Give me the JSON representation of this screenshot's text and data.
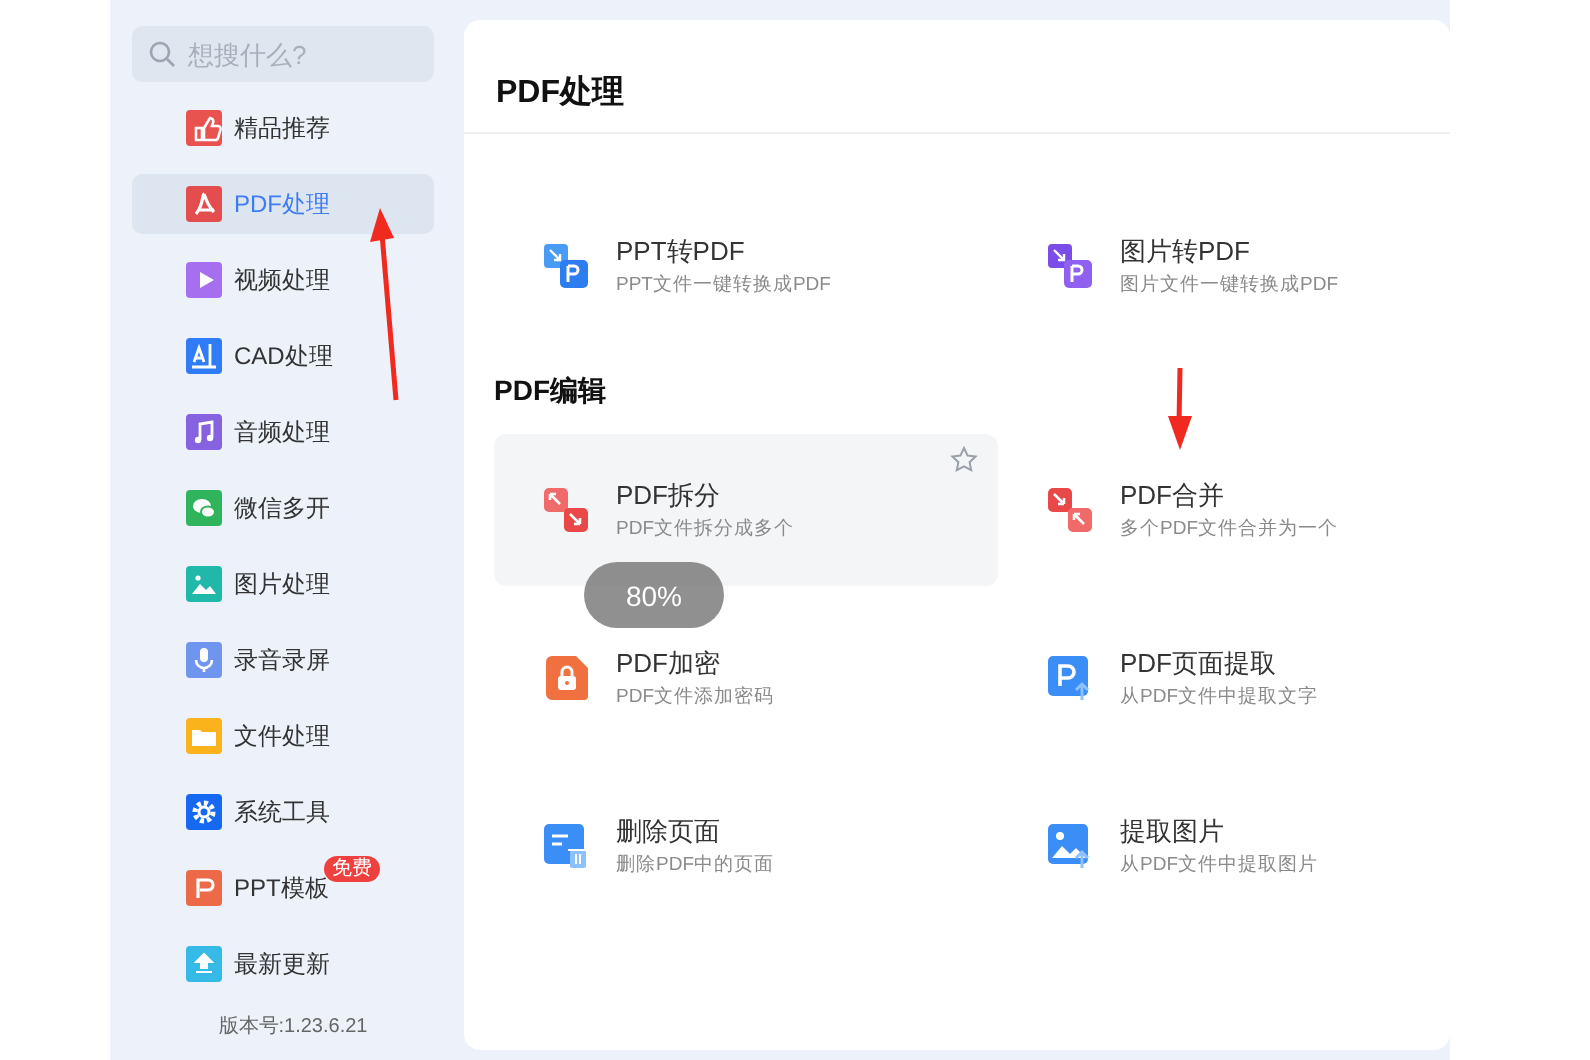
{
  "sidebar": {
    "search": {
      "placeholder": "想搜什么?"
    },
    "items": [
      {
        "label": "精品推荐",
        "kind": "thumb",
        "selected": false
      },
      {
        "label": "PDF处理",
        "kind": "pdf",
        "selected": true
      },
      {
        "label": "视频处理",
        "kind": "video",
        "selected": false
      },
      {
        "label": "CAD处理",
        "kind": "cad",
        "selected": false
      },
      {
        "label": "音频处理",
        "kind": "audio",
        "selected": false
      },
      {
        "label": "微信多开",
        "kind": "chat",
        "selected": false
      },
      {
        "label": "图片处理",
        "kind": "image",
        "selected": false
      },
      {
        "label": "录音录屏",
        "kind": "mic",
        "selected": false
      },
      {
        "label": "文件处理",
        "kind": "folder",
        "selected": false
      },
      {
        "label": "系统工具",
        "kind": "gear",
        "selected": false
      },
      {
        "label": "PPT模板",
        "kind": "ppt",
        "selected": false,
        "badge": "免费"
      },
      {
        "label": "最新更新",
        "kind": "update",
        "selected": false
      }
    ],
    "version": "版本号:1.23.6.21"
  },
  "main": {
    "title": "PDF处理",
    "sections": [
      {
        "tools": [
          {
            "name": "PPT转PDF",
            "description": "PPT文件一键转换成PDF",
            "kind": "ppt2pdf",
            "hovered": false
          },
          {
            "name": "图片转PDF",
            "description": "图片文件一键转换成PDF",
            "kind": "img2pdf",
            "hovered": false
          }
        ]
      },
      {
        "heading": "PDF编辑",
        "tools": [
          {
            "name": "PDF拆分",
            "description": "PDF文件拆分成多个",
            "kind": "split",
            "hovered": true
          },
          {
            "name": "PDF合并",
            "description": "多个PDF文件合并为一个",
            "kind": "merge",
            "hovered": false
          },
          {
            "name": "PDF加密",
            "description": "PDF文件添加密码",
            "kind": "lock",
            "hovered": false
          },
          {
            "name": "PDF页面提取",
            "description": "从PDF文件中提取文字",
            "kind": "extract",
            "hovered": false
          },
          {
            "name": "删除页面",
            "description": "删除PDF中的页面",
            "kind": "delete",
            "hovered": false
          },
          {
            "name": "提取图片",
            "description": "从PDF文件中提取图片",
            "kind": "picture",
            "hovered": false
          }
        ]
      }
    ]
  },
  "toast": "80%"
}
